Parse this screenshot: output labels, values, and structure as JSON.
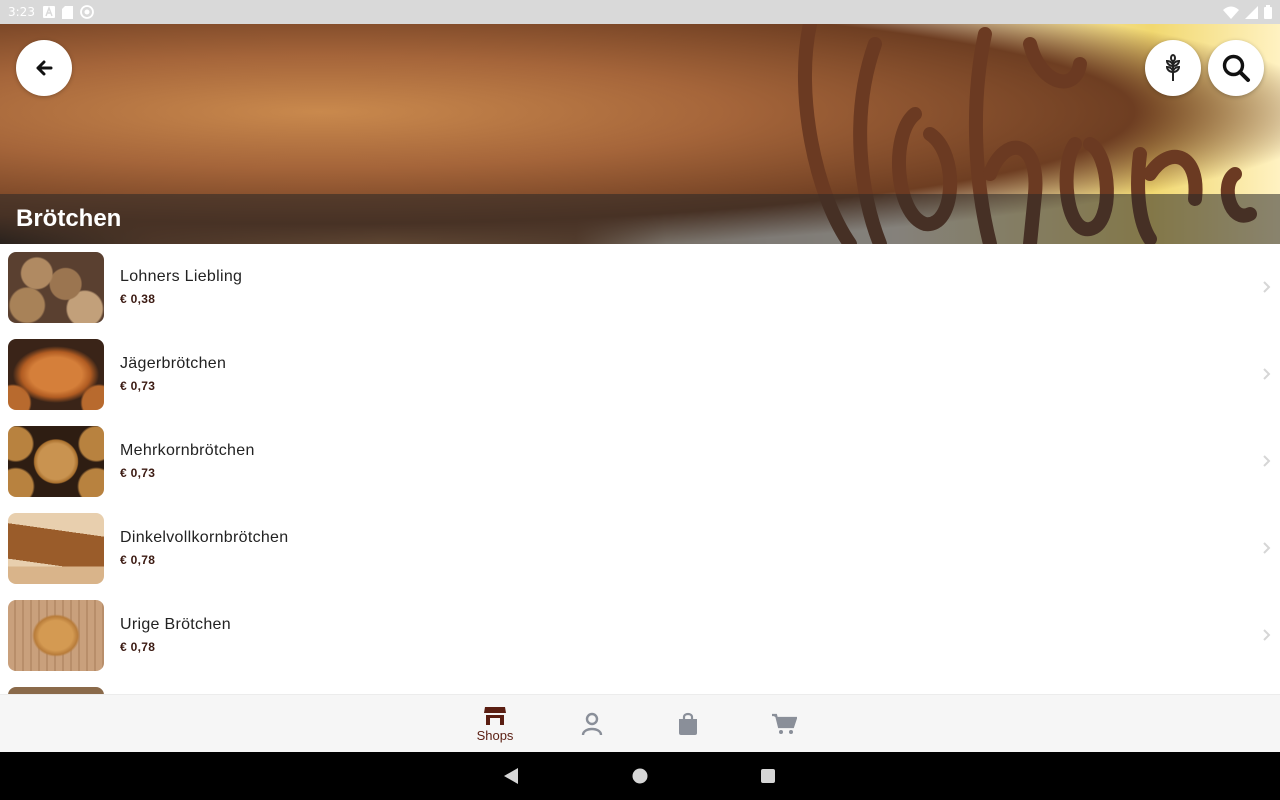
{
  "status_bar": {
    "time": "3:23"
  },
  "header": {
    "title": "Brötchen",
    "back_icon": "arrow-left-icon",
    "grain_icon": "wheat-icon",
    "search_icon": "search-icon"
  },
  "products": [
    {
      "name": "Lohners Liebling",
      "price": "€ 0,38"
    },
    {
      "name": "Jägerbrötchen",
      "price": "€ 0,73"
    },
    {
      "name": "Mehrkornbrötchen",
      "price": "€ 0,73"
    },
    {
      "name": "Dinkelvollkornbrötchen",
      "price": "€ 0,78"
    },
    {
      "name": "Urige Brötchen",
      "price": "€ 0,78"
    }
  ],
  "bottom_nav": {
    "items": [
      {
        "label": "Shops",
        "icon": "store-icon",
        "active": true
      },
      {
        "label": "",
        "icon": "user-icon",
        "active": false
      },
      {
        "label": "",
        "icon": "bag-icon",
        "active": false
      },
      {
        "label": "",
        "icon": "cart-icon",
        "active": false
      }
    ]
  },
  "colors": {
    "accent": "#5a1e12",
    "inactive_icon": "#8a8f99"
  }
}
